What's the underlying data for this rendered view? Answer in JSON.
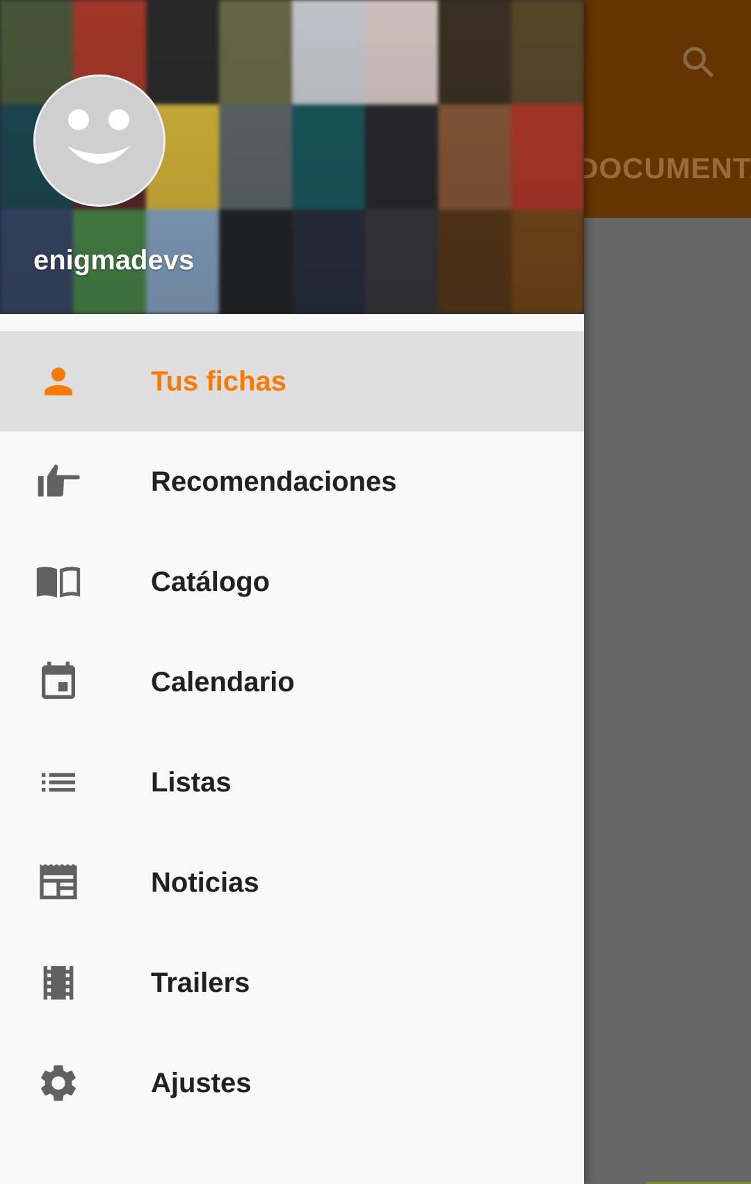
{
  "app_bar": {
    "tab_label": "DOCUMENTA",
    "search_icon": "search-icon",
    "background_color": "#653500"
  },
  "drawer": {
    "username": "enigmadevs",
    "avatar_icon": "smiley-avatar-icon",
    "accent_color": "#f57c00",
    "items": [
      {
        "label": "Tus fichas",
        "icon": "person-icon",
        "active": true
      },
      {
        "label": "Recomendaciones",
        "icon": "thumb-pointing-icon",
        "active": false
      },
      {
        "label": "Catálogo",
        "icon": "book-icon",
        "active": false
      },
      {
        "label": "Calendario",
        "icon": "calendar-icon",
        "active": false
      },
      {
        "label": "Listas",
        "icon": "list-icon",
        "active": false
      },
      {
        "label": "Noticias",
        "icon": "news-icon",
        "active": false
      },
      {
        "label": "Trailers",
        "icon": "film-icon",
        "active": false
      },
      {
        "label": "Ajustes",
        "icon": "gear-icon",
        "active": false
      }
    ]
  }
}
